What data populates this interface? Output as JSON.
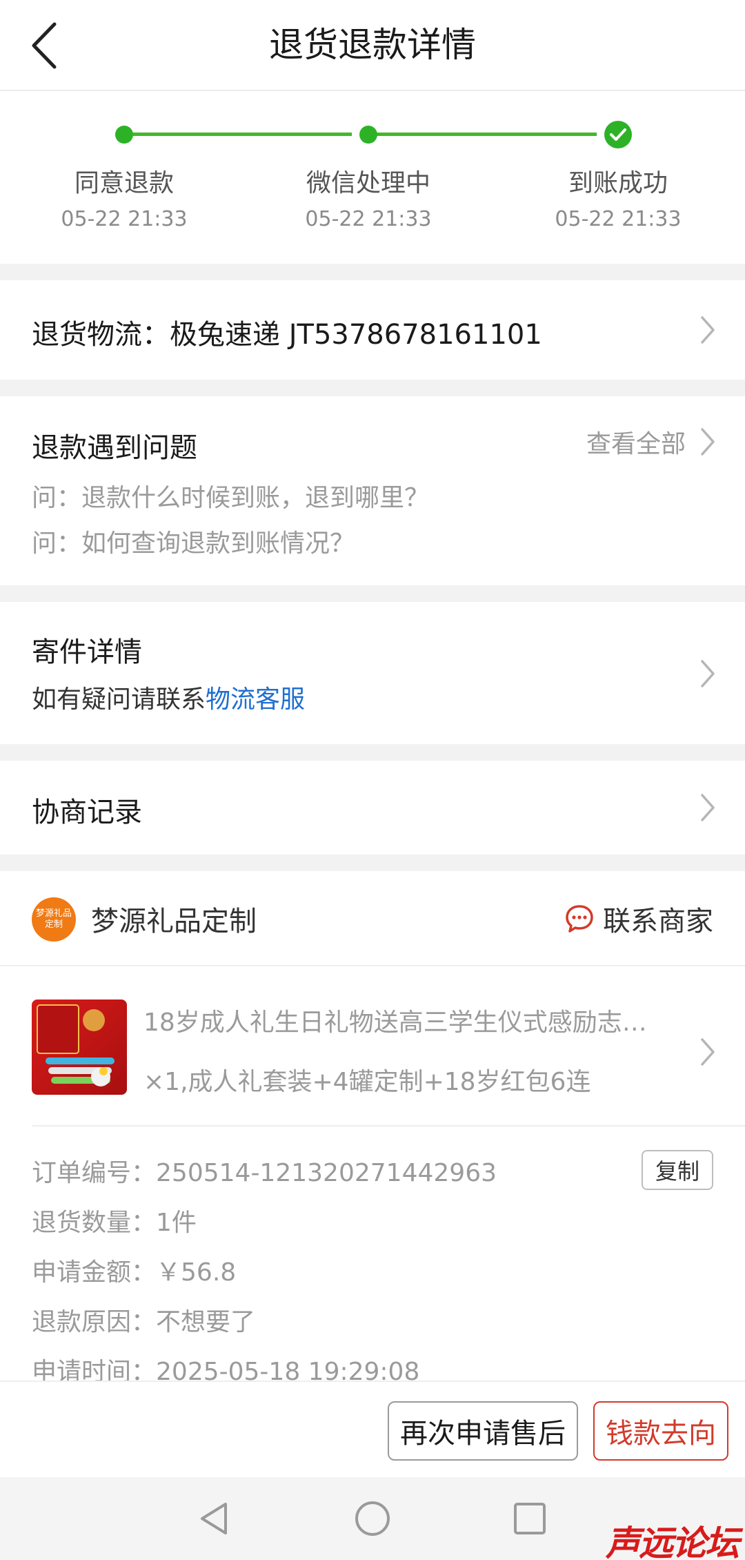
{
  "header": {
    "title": "退货退款详情"
  },
  "progress": {
    "steps": [
      {
        "label": "同意退款",
        "time": "05-22 21:33"
      },
      {
        "label": "微信处理中",
        "time": "05-22 21:33"
      },
      {
        "label": "到账成功",
        "time": "05-22 21:33"
      }
    ],
    "accent": "#2db227"
  },
  "logistics": {
    "label": "退货物流：",
    "carrier": "极兔速递",
    "tracking": "JT5378678161101"
  },
  "faq": {
    "title": "退款遇到问题",
    "view_all": "查看全部",
    "questions": [
      "问：退款什么时候到账，退到哪里？",
      "问：如何查询退款到账情况？"
    ]
  },
  "shipping": {
    "title": "寄件详情",
    "hint": "如有疑问请联系",
    "link": "物流客服"
  },
  "negotiation": {
    "title": "协商记录"
  },
  "shop": {
    "logo_text": "梦源礼品定制",
    "name": "梦源礼品定制",
    "contact": "联系商家"
  },
  "product": {
    "title": "18岁成人礼生日礼物送高三学生仪式感励志…",
    "sku": "×1,成人礼套装+4罐定制+18岁红包6连"
  },
  "order": {
    "number_label": "订单编号：",
    "number": "250514-121320271442963",
    "copy": "复制",
    "qty_label": "退货数量：",
    "qty": "1件",
    "amount_label": "申请金额：",
    "amount": "￥56.8",
    "reason_label": "退款原因：",
    "reason": "不想要了",
    "time_label": "申请时间：",
    "time": "2025-05-18 19:29:08"
  },
  "actions": {
    "reapply": "再次申请售后",
    "money_flow": "钱款去向"
  },
  "watermark": "声远论坛",
  "colors": {
    "green": "#2db227",
    "red": "#d23a2a",
    "link": "#1f6fd1",
    "logo": "#f07a14"
  }
}
